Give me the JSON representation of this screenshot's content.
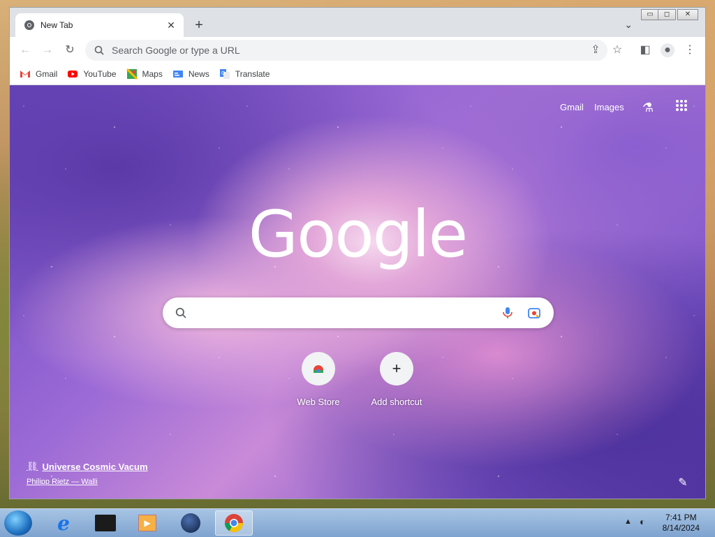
{
  "tab": {
    "title": "New Tab"
  },
  "omnibox": {
    "placeholder": "Search Google or type a URL"
  },
  "bookmarks": [
    {
      "label": "Gmail",
      "icon": "gmail-icon"
    },
    {
      "label": "YouTube",
      "icon": "youtube-icon"
    },
    {
      "label": "Maps",
      "icon": "maps-icon"
    },
    {
      "label": "News",
      "icon": "news-icon"
    },
    {
      "label": "Translate",
      "icon": "translate-icon"
    }
  ],
  "ntp": {
    "gmail_link": "Gmail",
    "images_link": "Images",
    "logo": "Google",
    "shortcuts": [
      {
        "label": "Web Store",
        "icon": "webstore-icon"
      },
      {
        "label": "Add shortcut",
        "icon": "plus-icon"
      }
    ],
    "attribution": {
      "title": "Universe Cosmic Vacum",
      "author": "Philipp Rietz — Walli"
    }
  },
  "taskbar": {
    "time": "7:41 PM",
    "date": "8/14/2024"
  }
}
